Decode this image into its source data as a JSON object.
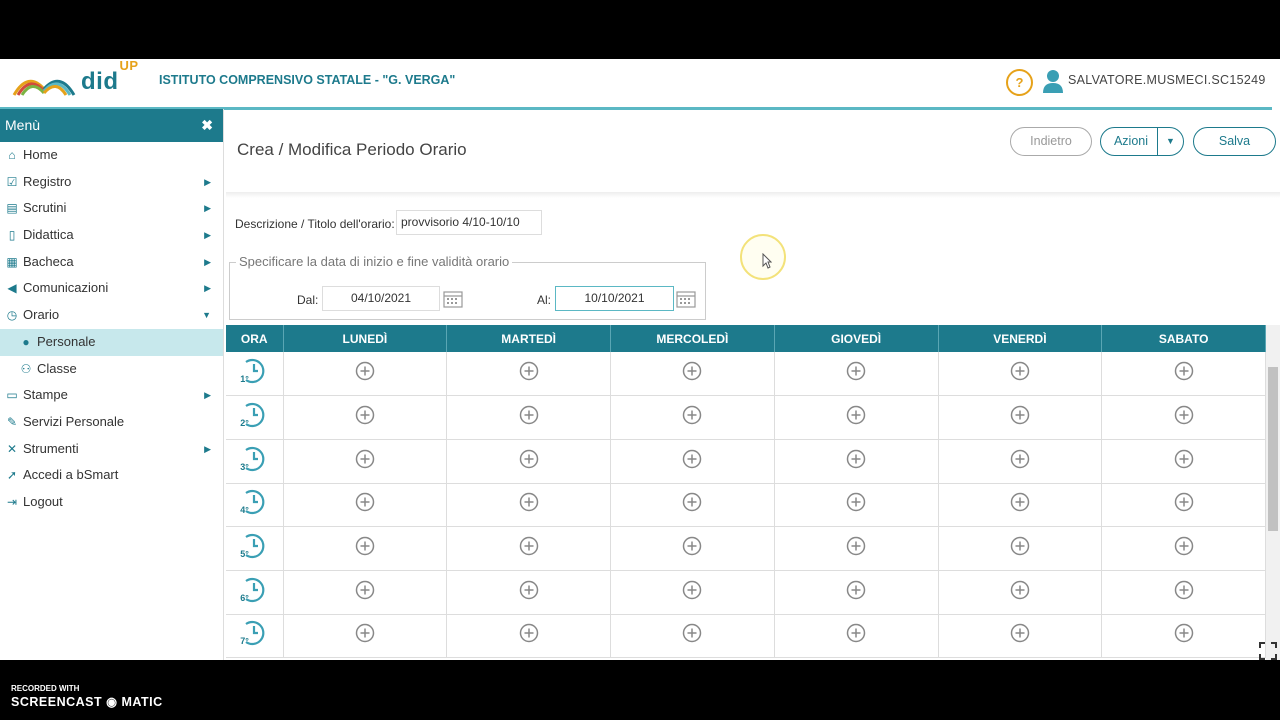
{
  "header": {
    "brand": "did",
    "brand_sup": "UP",
    "school": "ISTITUTO COMPRENSIVO STATALE - \"G. VERGA\"",
    "help": "?",
    "username": "SALVATORE.MUSMECI.SC15249"
  },
  "sidebar": {
    "title": "Menù",
    "close": "✖",
    "items": [
      {
        "label": "Home",
        "icon": "home-icon",
        "arrow": ""
      },
      {
        "label": "Registro",
        "icon": "registro-icon",
        "arrow": "▶"
      },
      {
        "label": "Scrutini",
        "icon": "scrutini-icon",
        "arrow": "▶"
      },
      {
        "label": "Didattica",
        "icon": "book-icon",
        "arrow": "▶"
      },
      {
        "label": "Bacheca",
        "icon": "bacheca-icon",
        "arrow": "▶"
      },
      {
        "label": "Comunicazioni",
        "icon": "megaphone-icon",
        "arrow": "▶"
      },
      {
        "label": "Orario",
        "icon": "clock-icon",
        "arrow": "▼"
      },
      {
        "label": "Personale",
        "icon": "user-icon",
        "arrow": ""
      },
      {
        "label": "Classe",
        "icon": "users-icon",
        "arrow": ""
      },
      {
        "label": "Stampe",
        "icon": "printer-icon",
        "arrow": "▶"
      },
      {
        "label": "Servizi Personale",
        "icon": "edit-icon",
        "arrow": ""
      },
      {
        "label": "Strumenti",
        "icon": "tools-icon",
        "arrow": "▶"
      },
      {
        "label": "Accedi a bSmart",
        "icon": "rocket-icon",
        "arrow": ""
      },
      {
        "label": "Logout",
        "icon": "logout-icon",
        "arrow": ""
      }
    ]
  },
  "page": {
    "title": "Crea / Modifica Periodo Orario",
    "back_label": "Indietro",
    "actions_label": "Azioni",
    "save_label": "Salva"
  },
  "form": {
    "desc_label": "Descrizione / Titolo dell'orario:",
    "desc_value": "provvisorio 4/10-10/10",
    "legend": "Specificare la data di inizio e fine validità orario",
    "from_label": "Dal:",
    "from_value": "04/10/2021",
    "to_label": "Al:",
    "to_value": "10/10/2021"
  },
  "table": {
    "headers": [
      "ORA",
      "LUNEDÌ",
      "MARTEDÌ",
      "MERCOLEDÌ",
      "GIOVEDÌ",
      "VENERDÌ",
      "SABATO"
    ],
    "rows": [
      "1°",
      "2°",
      "3°",
      "4°",
      "5°",
      "6°",
      "7°"
    ]
  },
  "footer": {
    "rec_label": "RECORDED WITH",
    "rec_brand": "SCREENCAST ◉ MATIC"
  },
  "colors": {
    "primary": "#1d7a8c",
    "accent": "#e6a21a",
    "active_bg": "#c7e8ec"
  }
}
